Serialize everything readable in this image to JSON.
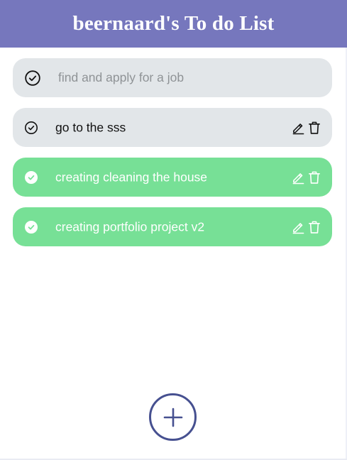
{
  "header": {
    "title": "beernaard's To do List"
  },
  "new_task": {
    "placeholder": "find and apply for a job",
    "value": ""
  },
  "todos": [
    {
      "text": "go to the sss",
      "completed": false,
      "icon": "circle-check-outline-icon"
    },
    {
      "text": "creating cleaning the house",
      "completed": true,
      "icon": "circle-check-filled-icon"
    },
    {
      "text": "creating portfolio project v2",
      "completed": true,
      "icon": "circle-check-filled-icon"
    }
  ],
  "icons": {
    "edit": "edit-pencil-icon",
    "delete": "trash-icon",
    "add": "plus-icon"
  },
  "colors": {
    "header": "#7677bd",
    "pending_row": "#e2e6e9",
    "completed_row": "#77e096",
    "add_button_border": "#465090"
  }
}
